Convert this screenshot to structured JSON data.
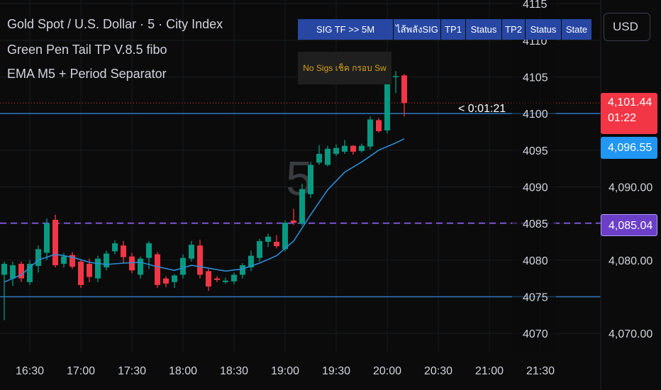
{
  "header": {
    "line1": "Gold Spot / U.S. Dollar · 5 · City Index",
    "line2": "Green Pen Tail TP V.8.5 fibo",
    "line3": "EMA M5 + Period Separator"
  },
  "currency_button": "USD",
  "watermark": "5",
  "countdown_label": "< 0:01:21",
  "signal_table": {
    "cells": [
      "SIG TF >> 5M",
      "ไส้พลังSIG",
      "TP1",
      "Status",
      "TP2",
      "Status",
      "State"
    ],
    "note": "No Sigs เช็ค กรอบ Sw"
  },
  "price_tags": {
    "last_price": "4,101.44",
    "last_timer": "01:22",
    "ema_price": "4,096.55",
    "dashed_price": "4,085.04"
  },
  "colors": {
    "background": "#0b0b0b",
    "bull": "#089981",
    "bear": "#f23645",
    "ema": "#2a8fd8",
    "dashed_line": "#7b52d6",
    "horizontal_line": "#2e78c4",
    "last_price_tag": "#f23645",
    "ema_tag": "#2196f3",
    "dashed_tag": "#6b3fc7",
    "table_cell": "#2747a3"
  },
  "chart_data": {
    "type": "candlestick",
    "title": "Gold Spot / U.S. Dollar · 5 · City Index",
    "timeframe_minutes": 5,
    "x_tick_labels": [
      "16:30",
      "17:00",
      "17:30",
      "18:00",
      "18:30",
      "19:00",
      "19:30",
      "20:00",
      "20:30",
      "21:00",
      "21:30"
    ],
    "x_ticks": [
      "16:30",
      "17:00",
      "17:30",
      "18:00",
      "18:30",
      "19:00",
      "19:30",
      "20:00",
      "20:30",
      "21:00",
      "21:30"
    ],
    "ylim": [
      4067.5,
      4115.5
    ],
    "inner_y_ticks": [
      4070,
      4075,
      4080,
      4085,
      4090,
      4095,
      4100,
      4105,
      4110,
      4115
    ],
    "outer_y_ticks": [
      "4,070.00",
      "4,080.00",
      "4,090.00"
    ],
    "horizontal_lines": [
      4100,
      4075
    ],
    "dashed_line": 4085.04,
    "last_price": 4101.44,
    "ema_last": 4096.55,
    "candles": [
      {
        "t": "16:15",
        "o": 4078.0,
        "h": 4079.8,
        "l": 4071.8,
        "c": 4079.5
      },
      {
        "t": "16:20",
        "o": 4077.5,
        "h": 4079.8,
        "l": 4076.5,
        "c": 4079.3
      },
      {
        "t": "16:25",
        "o": 4079.5,
        "h": 4079.8,
        "l": 4077.0,
        "c": 4077.5
      },
      {
        "t": "16:30",
        "o": 4077.0,
        "h": 4080.0,
        "l": 4076.6,
        "c": 4079.5
      },
      {
        "t": "16:35",
        "o": 4079.2,
        "h": 4082.0,
        "l": 4078.3,
        "c": 4081.5
      },
      {
        "t": "16:40",
        "o": 4081.0,
        "h": 4085.7,
        "l": 4080.0,
        "c": 4085.0
      },
      {
        "t": "16:45",
        "o": 4085.5,
        "h": 4086.2,
        "l": 4079.0,
        "c": 4079.3
      },
      {
        "t": "16:50",
        "o": 4079.5,
        "h": 4081.0,
        "l": 4079.0,
        "c": 4080.5
      },
      {
        "t": "16:55",
        "o": 4080.7,
        "h": 4081.1,
        "l": 4078.8,
        "c": 4079.1
      },
      {
        "t": "17:00",
        "o": 4079.8,
        "h": 4080.0,
        "l": 4076.2,
        "c": 4076.6
      },
      {
        "t": "17:05",
        "o": 4079.5,
        "h": 4080.2,
        "l": 4077.0,
        "c": 4077.7
      },
      {
        "t": "17:10",
        "o": 4077.5,
        "h": 4080.6,
        "l": 4077.0,
        "c": 4080.2
      },
      {
        "t": "17:15",
        "o": 4079.0,
        "h": 4081.3,
        "l": 4078.6,
        "c": 4080.9
      },
      {
        "t": "17:20",
        "o": 4081.2,
        "h": 4082.7,
        "l": 4080.8,
        "c": 4082.3
      },
      {
        "t": "17:25",
        "o": 4082.0,
        "h": 4082.6,
        "l": 4079.5,
        "c": 4080.4
      },
      {
        "t": "17:30",
        "o": 4080.5,
        "h": 4081.0,
        "l": 4078.2,
        "c": 4078.6
      },
      {
        "t": "17:35",
        "o": 4078.0,
        "h": 4080.5,
        "l": 4077.5,
        "c": 4080.2
      },
      {
        "t": "17:40",
        "o": 4080.3,
        "h": 4082.6,
        "l": 4078.8,
        "c": 4082.3
      },
      {
        "t": "17:45",
        "o": 4080.8,
        "h": 4081.1,
        "l": 4076.2,
        "c": 4076.6
      },
      {
        "t": "17:50",
        "o": 4077.5,
        "h": 4077.8,
        "l": 4076.3,
        "c": 4076.8
      },
      {
        "t": "17:55",
        "o": 4077.0,
        "h": 4078.1,
        "l": 4076.2,
        "c": 4077.9
      },
      {
        "t": "18:00",
        "o": 4078.0,
        "h": 4080.8,
        "l": 4077.5,
        "c": 4080.3
      },
      {
        "t": "18:05",
        "o": 4080.2,
        "h": 4082.6,
        "l": 4079.8,
        "c": 4082.1
      },
      {
        "t": "18:10",
        "o": 4082.0,
        "h": 4082.8,
        "l": 4077.5,
        "c": 4078.0
      },
      {
        "t": "18:15",
        "o": 4078.5,
        "h": 4078.8,
        "l": 4075.8,
        "c": 4076.4
      },
      {
        "t": "18:20",
        "o": 4077.5,
        "h": 4077.8,
        "l": 4077.0,
        "c": 4077.3
      },
      {
        "t": "18:25",
        "o": 4077.0,
        "h": 4077.6,
        "l": 4076.8,
        "c": 4077.2
      },
      {
        "t": "18:30",
        "o": 4077.1,
        "h": 4078.3,
        "l": 4076.7,
        "c": 4078.0
      },
      {
        "t": "18:35",
        "o": 4078.0,
        "h": 4079.6,
        "l": 4077.5,
        "c": 4079.3
      },
      {
        "t": "18:40",
        "o": 4079.0,
        "h": 4081.3,
        "l": 4078.5,
        "c": 4080.6
      },
      {
        "t": "18:45",
        "o": 4080.3,
        "h": 4082.9,
        "l": 4079.8,
        "c": 4082.6
      },
      {
        "t": "18:50",
        "o": 4082.5,
        "h": 4083.6,
        "l": 4081.8,
        "c": 4083.2
      },
      {
        "t": "18:55",
        "o": 4082.5,
        "h": 4083.4,
        "l": 4081.6,
        "c": 4081.9
      },
      {
        "t": "19:00",
        "o": 4081.5,
        "h": 4085.4,
        "l": 4081.2,
        "c": 4085.1
      },
      {
        "t": "19:05",
        "o": 4085.4,
        "h": 4087.0,
        "l": 4084.8,
        "c": 4085.1
      },
      {
        "t": "19:10",
        "o": 4085.0,
        "h": 4090.4,
        "l": 4084.7,
        "c": 4089.7
      },
      {
        "t": "19:15",
        "o": 4089.0,
        "h": 4093.4,
        "l": 4088.5,
        "c": 4093.0
      },
      {
        "t": "19:20",
        "o": 4093.3,
        "h": 4095.7,
        "l": 4093.0,
        "c": 4094.5
      },
      {
        "t": "19:25",
        "o": 4093.0,
        "h": 4095.6,
        "l": 4092.8,
        "c": 4095.2
      },
      {
        "t": "19:30",
        "o": 4094.5,
        "h": 4095.8,
        "l": 4094.2,
        "c": 4095.3
      },
      {
        "t": "19:35",
        "o": 4094.8,
        "h": 4096.4,
        "l": 4094.5,
        "c": 4095.6
      },
      {
        "t": "19:40",
        "o": 4095.6,
        "h": 4095.7,
        "l": 4094.4,
        "c": 4094.8
      },
      {
        "t": "19:45",
        "o": 4094.9,
        "h": 4095.9,
        "l": 4094.7,
        "c": 4095.6
      },
      {
        "t": "19:50",
        "o": 4095.5,
        "h": 4099.6,
        "l": 4095.1,
        "c": 4099.2
      },
      {
        "t": "19:55",
        "o": 4099.1,
        "h": 4099.4,
        "l": 4097.4,
        "c": 4097.6
      },
      {
        "t": "20:00",
        "o": 4097.7,
        "h": 4105.9,
        "l": 4097.3,
        "c": 4105.4
      },
      {
        "t": "20:05",
        "o": 4105.0,
        "h": 4105.8,
        "l": 4102.8,
        "c": 4105.1
      },
      {
        "t": "20:10",
        "o": 4105.2,
        "h": 4105.4,
        "l": 4099.6,
        "c": 4101.44
      }
    ],
    "ema_series": [
      {
        "t": "16:15",
        "v": 4077.0
      },
      {
        "t": "16:25",
        "v": 4078.0
      },
      {
        "t": "16:35",
        "v": 4080.0
      },
      {
        "t": "16:45",
        "v": 4080.8
      },
      {
        "t": "16:55",
        "v": 4080.4
      },
      {
        "t": "17:05",
        "v": 4079.7
      },
      {
        "t": "17:15",
        "v": 4079.4
      },
      {
        "t": "17:25",
        "v": 4079.6
      },
      {
        "t": "17:35",
        "v": 4079.7
      },
      {
        "t": "17:45",
        "v": 4079.1
      },
      {
        "t": "17:55",
        "v": 4078.6
      },
      {
        "t": "18:05",
        "v": 4079.3
      },
      {
        "t": "18:15",
        "v": 4078.9
      },
      {
        "t": "18:25",
        "v": 4078.5
      },
      {
        "t": "18:35",
        "v": 4078.8
      },
      {
        "t": "18:45",
        "v": 4079.6
      },
      {
        "t": "18:55",
        "v": 4080.6
      },
      {
        "t": "19:05",
        "v": 4082.6
      },
      {
        "t": "19:15",
        "v": 4086.2
      },
      {
        "t": "19:25",
        "v": 4089.6
      },
      {
        "t": "19:35",
        "v": 4092.0
      },
      {
        "t": "19:45",
        "v": 4093.4
      },
      {
        "t": "19:55",
        "v": 4095.0
      },
      {
        "t": "20:05",
        "v": 4096.0
      },
      {
        "t": "20:10",
        "v": 4096.55
      }
    ]
  }
}
